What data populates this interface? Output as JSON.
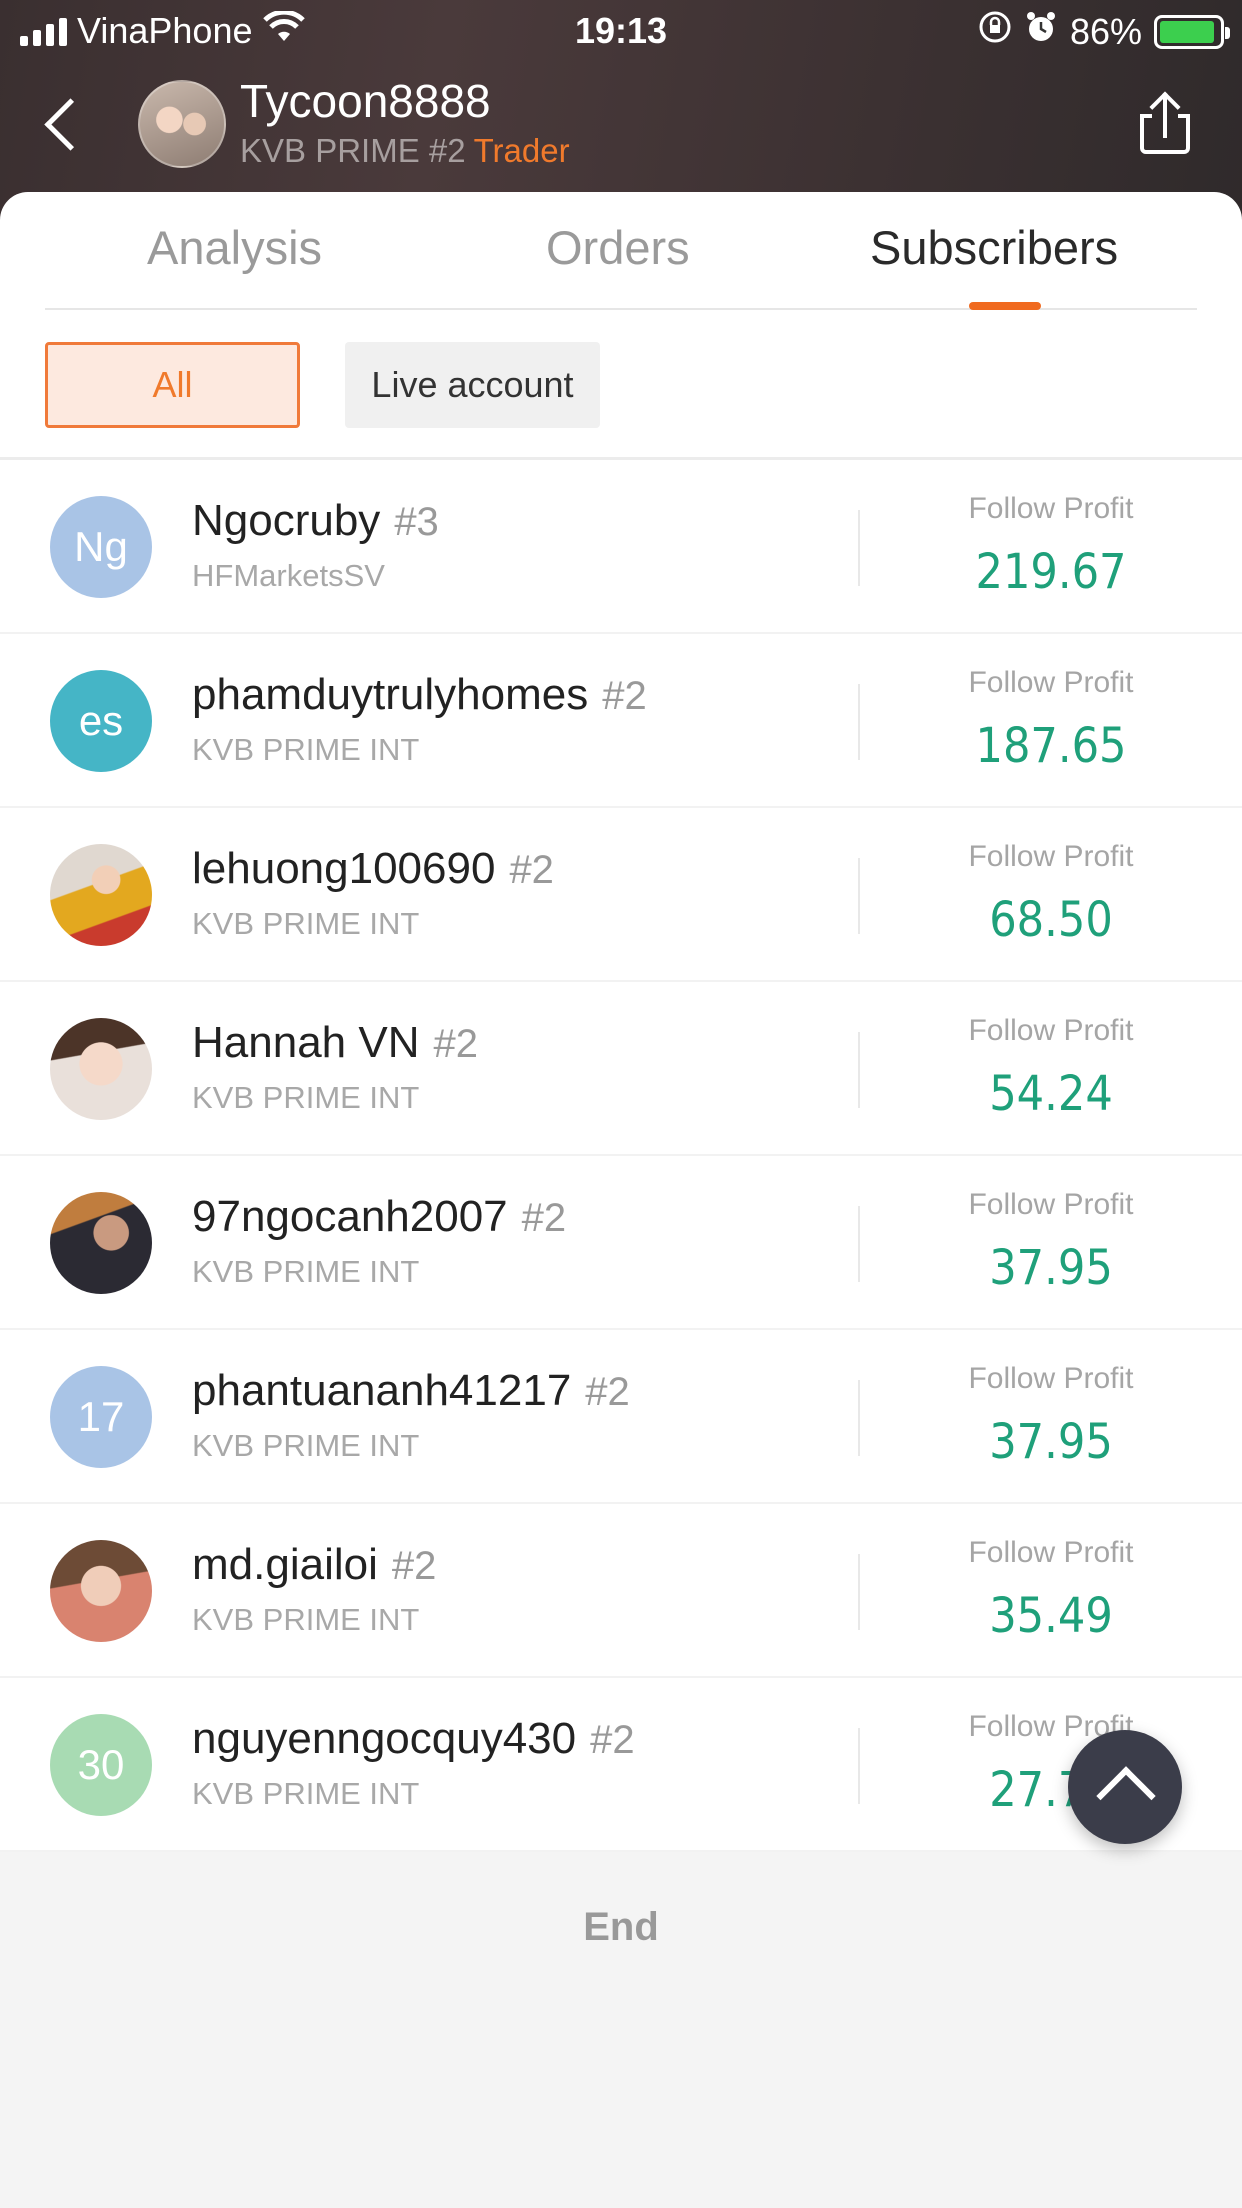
{
  "status_bar": {
    "carrier": "VinaPhone",
    "time": "19:13",
    "battery": "86%"
  },
  "header": {
    "title": "Tycoon8888",
    "subtitle": "KVB PRIME #2",
    "role": "Trader"
  },
  "tabs": [
    {
      "label": "Analysis"
    },
    {
      "label": "Orders"
    },
    {
      "label": "Subscribers"
    }
  ],
  "active_tab": "Subscribers",
  "filters": {
    "all": "All",
    "live": "Live account"
  },
  "subscribers": [
    {
      "avatar_text": "Ng",
      "avatar_color": "#a9c4e6",
      "name": "Ngocruby",
      "rank": "#3",
      "broker": "HFMarketsSV",
      "profit_label": "Follow Profit",
      "profit": "219.67"
    },
    {
      "avatar_text": "es",
      "avatar_color": "#45b5c6",
      "name": "phamduytrulyhomes",
      "rank": "#2",
      "broker": "KVB PRIME INT",
      "profit_label": "Follow Profit",
      "profit": "187.65"
    },
    {
      "avatar_text": "",
      "avatar_photo": "photo1",
      "name": "lehuong100690",
      "rank": "#2",
      "broker": "KVB PRIME INT",
      "profit_label": "Follow Profit",
      "profit": "68.50"
    },
    {
      "avatar_text": "",
      "avatar_photo": "photo2",
      "name": "Hannah VN",
      "rank": "#2",
      "broker": "KVB PRIME INT",
      "profit_label": "Follow Profit",
      "profit": "54.24"
    },
    {
      "avatar_text": "",
      "avatar_photo": "photo3",
      "name": "97ngocanh2007",
      "rank": "#2",
      "broker": "KVB PRIME INT",
      "profit_label": "Follow Profit",
      "profit": "37.95"
    },
    {
      "avatar_text": "17",
      "avatar_color": "#a9c4e6",
      "name": "phantuananh41217",
      "rank": "#2",
      "broker": "KVB PRIME INT",
      "profit_label": "Follow Profit",
      "profit": "37.95"
    },
    {
      "avatar_text": "",
      "avatar_photo": "photo4",
      "name": "md.giailoi",
      "rank": "#2",
      "broker": "KVB PRIME INT",
      "profit_label": "Follow Profit",
      "profit": "35.49"
    },
    {
      "avatar_text": "30",
      "avatar_color": "#a8dbb3",
      "name": "nguyenngocquy430",
      "rank": "#2",
      "broker": "KVB PRIME INT",
      "profit_label": "Follow Profit",
      "profit": "27.72"
    }
  ],
  "end_text": "End",
  "colors": {
    "accent": "#f06a1f",
    "profit_green": "#1fa07a"
  },
  "icons": {
    "back": "chevron-left-icon",
    "share": "share-icon",
    "scroll_top": "chevron-up-icon"
  }
}
